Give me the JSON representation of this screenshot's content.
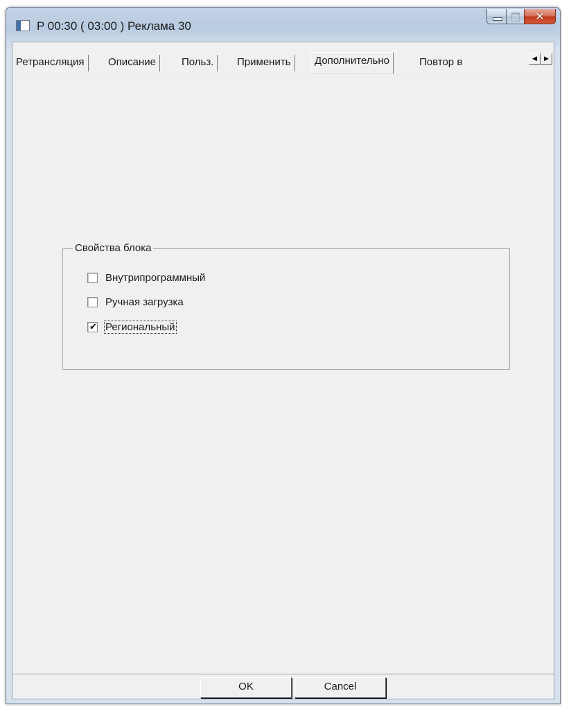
{
  "window": {
    "title": "P 00:30 ( 03:00 ) Реклама 30",
    "caption": {
      "minimize_icon": "minimize-icon",
      "maximize_icon": "maximize-icon",
      "close_glyph": "✕"
    }
  },
  "tabs": [
    {
      "label": "Ретрансляция",
      "selected": false
    },
    {
      "label": "Описание",
      "selected": false
    },
    {
      "label": "Польз.",
      "selected": false
    },
    {
      "label": "Применить",
      "selected": false
    },
    {
      "label": "Дополнительно",
      "selected": true
    },
    {
      "label": "Повтор в",
      "selected": false
    }
  ],
  "tab_scroll": {
    "left": "◀",
    "right": "▶"
  },
  "groupbox": {
    "title": "Свойства блока",
    "items": [
      {
        "label": "Внутрипрограммный",
        "checked": false
      },
      {
        "label": "Ручная загрузка",
        "checked": false
      },
      {
        "label": "Региональный",
        "checked": true
      }
    ],
    "checkmark": "✔"
  },
  "buttons": {
    "ok": "OK",
    "cancel": "Cancel"
  }
}
